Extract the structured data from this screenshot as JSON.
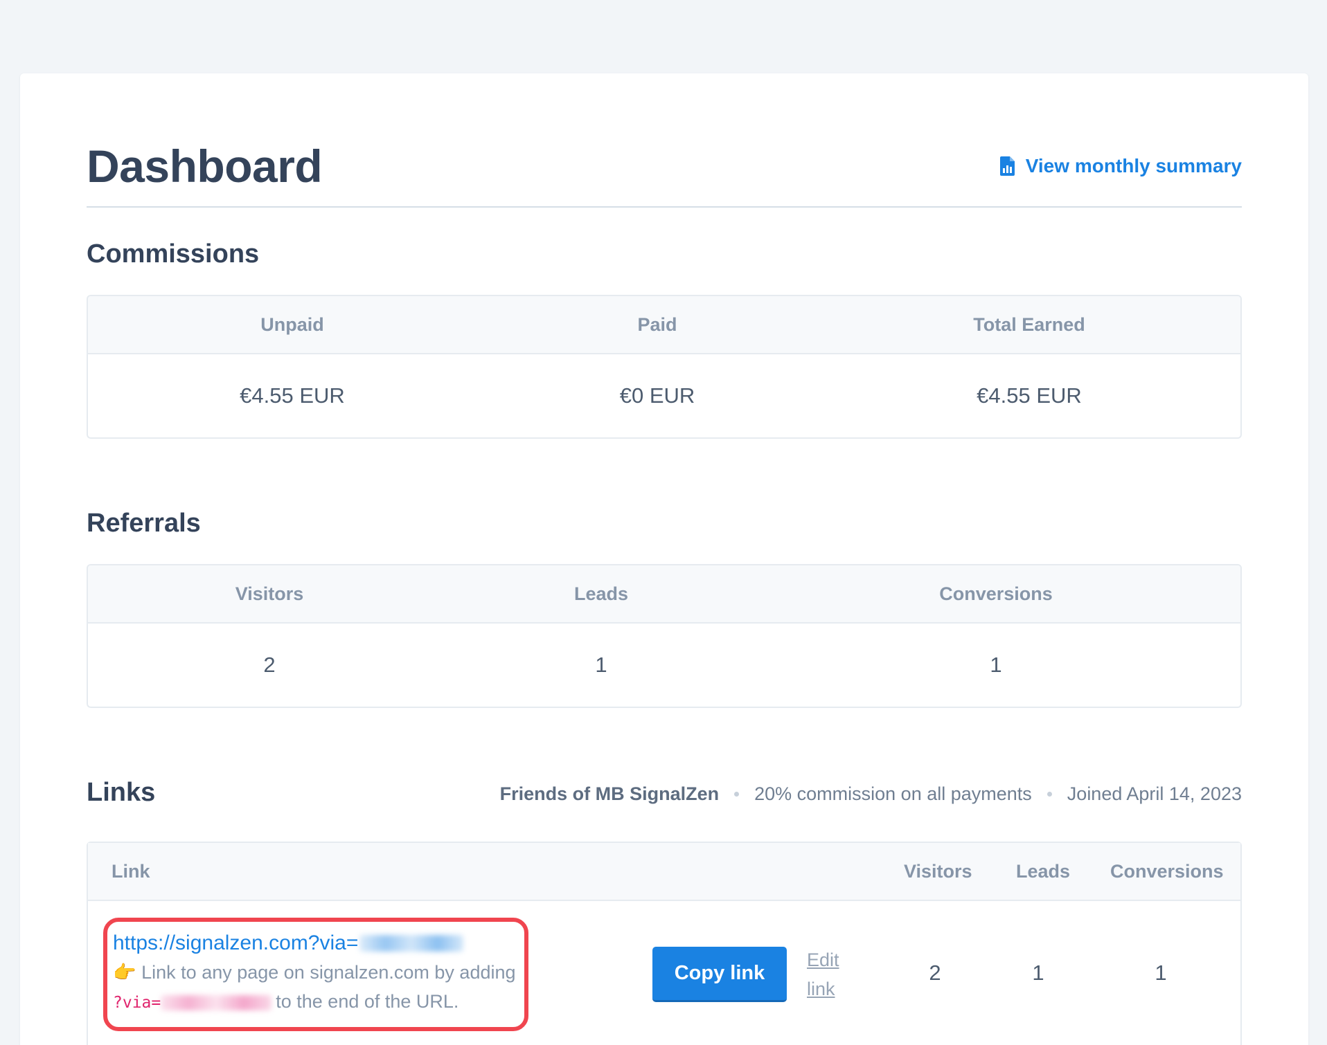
{
  "header": {
    "title": "Dashboard",
    "summary_link": "View monthly summary",
    "summary_icon": "document-chart-icon"
  },
  "commissions": {
    "title": "Commissions",
    "columns": [
      "Unpaid",
      "Paid",
      "Total Earned"
    ],
    "values": [
      "€4.55 EUR",
      "€0 EUR",
      "€4.55 EUR"
    ]
  },
  "referrals": {
    "title": "Referrals",
    "columns": [
      "Visitors",
      "Leads",
      "Conversions"
    ],
    "values": [
      "2",
      "1",
      "1"
    ]
  },
  "links": {
    "title": "Links",
    "program": "Friends of MB SignalZen",
    "commission": "20% commission on all payments",
    "joined": "Joined April 14, 2023",
    "columns": {
      "link": "Link",
      "visitors": "Visitors",
      "leads": "Leads",
      "conversions": "Conversions"
    },
    "row": {
      "url_prefix": "https://signalzen.com?via=",
      "hint_emoji": "👉",
      "hint_before": "Link to any page on signalzen.com by adding",
      "hint_code": "?via=",
      "hint_after": "to the end of the URL.",
      "copy_label": "Copy link",
      "edit_label": "Edit link",
      "visitors": "2",
      "leads": "1",
      "conversions": "1"
    }
  },
  "colors": {
    "accent": "#1a82e2",
    "highlight_border": "#f0454f",
    "code": "#e0246d",
    "background": "#f2f5f8"
  }
}
